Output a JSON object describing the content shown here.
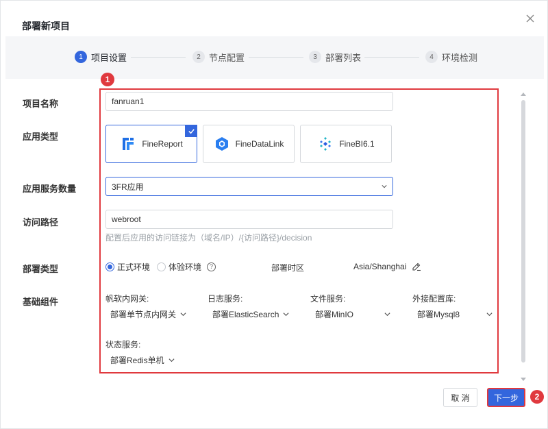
{
  "dialog": {
    "title": "部署新项目",
    "close_icon": "close-icon"
  },
  "steps": [
    {
      "num": "1",
      "label": "项目设置",
      "active": true
    },
    {
      "num": "2",
      "label": "节点配置",
      "active": false
    },
    {
      "num": "3",
      "label": "部署列表",
      "active": false
    },
    {
      "num": "4",
      "label": "环境检测",
      "active": false
    }
  ],
  "annotations": {
    "badge1": "1",
    "badge2": "2",
    "highlight_color": "#e0393e"
  },
  "form": {
    "project_name": {
      "label": "项目名称",
      "value": "fanruan1"
    },
    "app_type": {
      "label": "应用类型",
      "options": [
        {
          "label": "FineReport",
          "icon": "finereport-icon",
          "selected": true
        },
        {
          "label": "FineDataLink",
          "icon": "finedatalink-icon",
          "selected": false
        },
        {
          "label": "FineBI6.1",
          "icon": "finebi-icon",
          "selected": false
        }
      ]
    },
    "service_count": {
      "label": "应用服务数量",
      "value": "3FR应用"
    },
    "access_path": {
      "label": "访问路径",
      "value": "webroot",
      "hint": "配置后应用的访问链接为（域名/IP）/{访问路径}/decision"
    },
    "deploy_type": {
      "label": "部署类型",
      "options": [
        {
          "label": "正式环境",
          "checked": true
        },
        {
          "label": "体验环境",
          "checked": false
        }
      ],
      "help_icon": "?",
      "timezone_label": "部署时区",
      "timezone_value": "Asia/Shanghai"
    },
    "base_components": {
      "label": "基础组件",
      "items": [
        {
          "label": "帆软内网关:",
          "value": "部署单节点内网关"
        },
        {
          "label": "日志服务:",
          "value": "部署ElasticSearch"
        },
        {
          "label": "文件服务:",
          "value": "部署MinIO"
        },
        {
          "label": "外接配置库:",
          "value": "部署Mysql8"
        },
        {
          "label": "状态服务:",
          "value": "部署Redis单机"
        }
      ]
    }
  },
  "footer": {
    "cancel_label": "取 消",
    "next_label": "下一步"
  },
  "colors": {
    "primary": "#3366dd",
    "annotation": "#e0393e"
  }
}
